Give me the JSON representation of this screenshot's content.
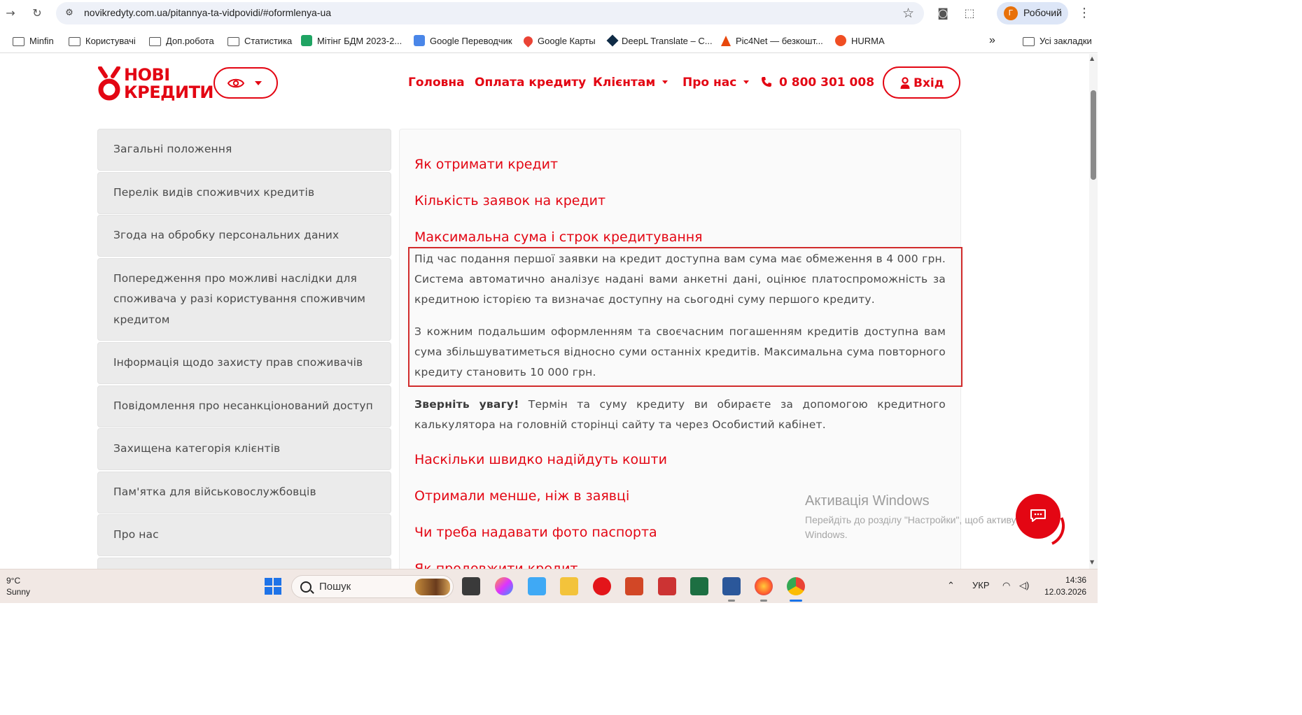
{
  "browser": {
    "url": "novikredyty.com.ua/pitannya-ta-vidpovidi/#oformlenya-ua",
    "profile_label": "Робочий",
    "profile_initial": "Г",
    "bookmarks": [
      "Minfin",
      "Користувачі",
      "Доп.робота",
      "Статистика",
      "Мітінг БДМ 2023-2...",
      "Google Переводчик",
      "Google Карты",
      "DeepL Translate – C...",
      "Pic4Net — безкошт...",
      "HURMA"
    ],
    "overflow_label": "»",
    "all_bookmarks": "Усі закладки"
  },
  "site": {
    "logo_line1": "НОВІ",
    "logo_line2": "КРЕДИТИ",
    "nav": {
      "home": "Головна",
      "payment": "Оплата кредиту",
      "clients": "Клієнтам",
      "about": "Про нас",
      "phone": "0 800 301 008"
    },
    "login": "Вхід",
    "brand_color": "#e30613"
  },
  "sidebar": {
    "items": [
      "Загальні положення",
      "Перелік видів споживчих кредитів",
      "Згода на обробку персональних даних",
      "Попередження про можливі наслідки для споживача у разі користування споживчим кредитом",
      "Інформація щодо захисту прав споживачів",
      "Повідомлення про несанкціонований доступ",
      "Захищена категорія клієнтів",
      "Пам'ятка для військовослужбовців",
      "Про нас"
    ]
  },
  "content": {
    "questions": [
      "Як отримати кредит",
      "Кількість заявок на кредит",
      "Максимальна сума і строк кредитування",
      "Наскільки швидко надійдуть кошти",
      "Отримали менше, ніж в заявці",
      "Чи треба надавати фото паспорта",
      "Як продовжити кредит"
    ],
    "answer_p1": "Під час подання першої заявки на кредит доступна вам сума має обмеження в 4 000 грн. Система автоматично аналізує надані вами анкетні дані, оцінює платоспроможність за кредитною історією та визначає доступну на сьогодні суму першого кредиту.",
    "answer_p2": "З кожним подальшим оформленням та своєчасним погашенням кредитів доступна вам сума збільшуватиметься відносно суми останніх кредитів. Максимальна сума повторного кредиту становить 10 000 грн.",
    "note_bold": "Зверніть увагу!",
    "note_text": " Термін та суму кредиту ви обираєте за допомогою кредитного калькулятора на головній сторінці сайту та через Особистий кабінет."
  },
  "watermark": {
    "title": "Активація Windows",
    "subtitle": "Перейдіть до розділу \"Настройки\", щоб активувати Windows."
  },
  "taskbar": {
    "temp": "9°C",
    "weather": "Sunny",
    "search_placeholder": "Пошук",
    "lang": "УКР",
    "time": "14:36",
    "date": "12.03.2026"
  }
}
